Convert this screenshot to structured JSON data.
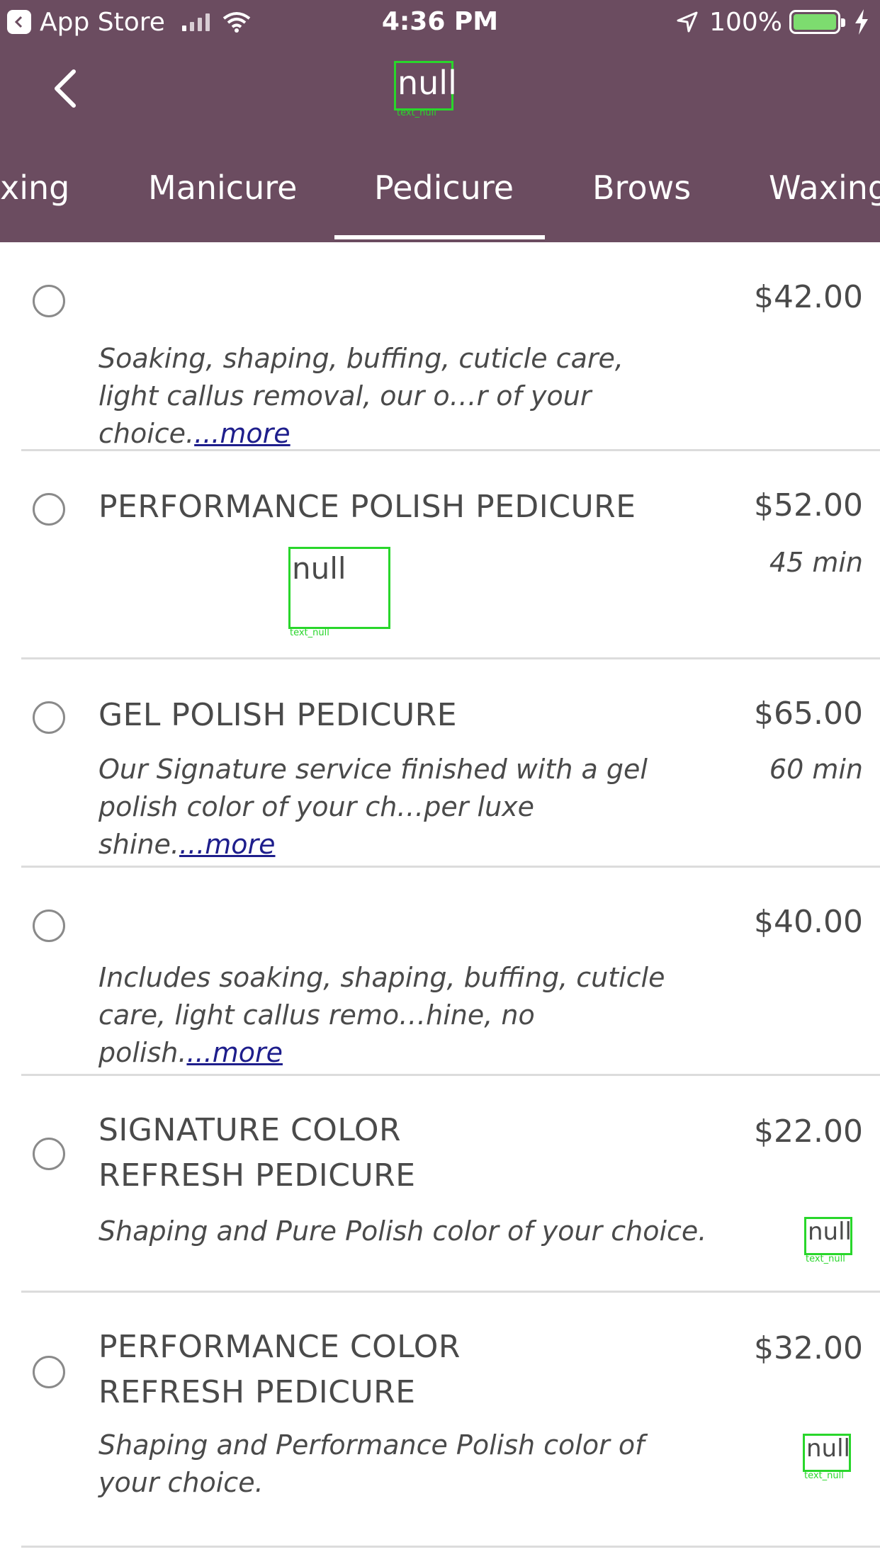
{
  "status_bar": {
    "back_app": "App Store",
    "time": "4:36 PM",
    "battery": "100%"
  },
  "nav": {
    "title": "null",
    "title_tag": "text_null"
  },
  "tabs": [
    {
      "label": "xing"
    },
    {
      "label": "Manicure"
    },
    {
      "label": "Pedicure",
      "selected": true
    },
    {
      "label": "Brows"
    },
    {
      "label": "Waxing"
    }
  ],
  "services": [
    {
      "name": "",
      "price": "$42.00",
      "duration": "",
      "description": "Soaking, shaping, buffing, cuticle care, light callus removal, our o…r of your choice.",
      "more": "...more"
    },
    {
      "name": "PERFORMANCE POLISH PEDICURE",
      "price": "$52.00",
      "duration": "45 min",
      "description_placeholder": "null",
      "description_tag": "text_null"
    },
    {
      "name": "GEL POLISH PEDICURE",
      "price": "$65.00",
      "duration": "60 min",
      "description": "Our Signature service finished with a gel polish color of your ch…per luxe shine.",
      "more": "...more"
    },
    {
      "name": "",
      "price": "$40.00",
      "duration": "",
      "description": "Includes soaking, shaping, buffing, cuticle care, light callus remo…hine, no polish.",
      "more": "...more"
    },
    {
      "name_line1": "SIGNATURE COLOR",
      "name_line2": "REFRESH PEDICURE",
      "price": "$22.00",
      "duration_placeholder": "null",
      "duration_tag": "text_null",
      "description": "Shaping and Pure Polish color of your choice."
    },
    {
      "name_line1": "PERFORMANCE COLOR",
      "name_line2": "REFRESH PEDICURE",
      "price": "$32.00",
      "duration_placeholder": "null",
      "duration_tag": "text_null",
      "description_line1": "Shaping and Performance Polish color of",
      "description_line2": "your choice."
    }
  ],
  "colors": {
    "header_bg": "#6b4c60",
    "accent_box": "#29d62b",
    "link": "#1e1e8c"
  }
}
